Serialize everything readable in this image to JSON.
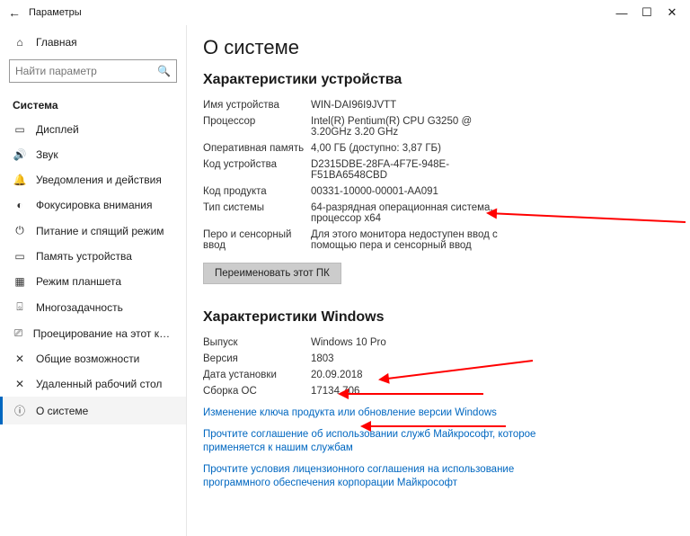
{
  "window": {
    "title": "Параметры"
  },
  "sidebar": {
    "home": "Главная",
    "search_placeholder": "Найти параметр",
    "section": "Система",
    "items": [
      {
        "icon": "▭",
        "label": "Дисплей"
      },
      {
        "icon": "🔊",
        "label": "Звук"
      },
      {
        "icon": "🔔",
        "label": "Уведомления и действия"
      },
      {
        "icon": "◐",
        "label": "Фокусировка внимания"
      },
      {
        "icon": "⏻",
        "label": "Питание и спящий режим"
      },
      {
        "icon": "▭",
        "label": "Память устройства"
      },
      {
        "icon": "▦",
        "label": "Режим планшета"
      },
      {
        "icon": "⌺",
        "label": "Многозадачность"
      },
      {
        "icon": "⎚",
        "label": "Проецирование на этот компьютер"
      },
      {
        "icon": "✕",
        "label": "Общие возможности"
      },
      {
        "icon": "✕",
        "label": "Удаленный рабочий стол"
      },
      {
        "icon": "ⓘ",
        "label": "О системе"
      }
    ],
    "active_index": 11
  },
  "page": {
    "title": "О системе",
    "device_section": "Характеристики устройства",
    "device_specs": [
      {
        "k": "Имя устройства",
        "v": "WIN-DAI96I9JVTT"
      },
      {
        "k": "Процессор",
        "v": "Intel(R) Pentium(R) CPU G3250 @ 3.20GHz   3.20 GHz"
      },
      {
        "k": "Оперативная память",
        "v": "4,00 ГБ (доступно: 3,87 ГБ)"
      },
      {
        "k": "Код устройства",
        "v": "D2315DBE-28FA-4F7E-948E-F51BA6548CBD"
      },
      {
        "k": "Код продукта",
        "v": "00331-10000-00001-AA091"
      },
      {
        "k": "Тип системы",
        "v": "64-разрядная операционная система, процессор x64"
      },
      {
        "k": "Перо и сенсорный ввод",
        "v": "Для этого монитора недоступен ввод с помощью пера и сенсорный ввод"
      }
    ],
    "rename_btn": "Переименовать этот ПК",
    "windows_section": "Характеристики Windows",
    "windows_specs": [
      {
        "k": "Выпуск",
        "v": "Windows 10 Pro"
      },
      {
        "k": "Версия",
        "v": "1803"
      },
      {
        "k": "Дата установки",
        "v": "20.09.2018"
      },
      {
        "k": "Сборка ОС",
        "v": "17134.706"
      }
    ],
    "links": [
      "Изменение ключа продукта или обновление версии Windows",
      "Прочтите соглашение об использовании служб Майкрософт, которое применяется к нашим службам",
      "Прочтите условия лицензионного соглашения на использование программного обеспечения корпорации Майкрософт"
    ]
  }
}
